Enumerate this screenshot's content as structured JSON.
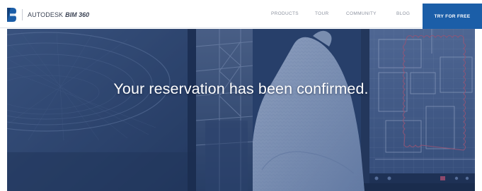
{
  "header": {
    "brand": "AUTODESK",
    "product": "BIM 360",
    "nav": [
      "PRODUCTS",
      "TOUR",
      "COMMUNITY",
      "BLOG"
    ],
    "cta_label": "TRY FOR FREE"
  },
  "hero": {
    "heading": "Your reservation has been confirmed."
  },
  "icons": {
    "logo": "autodesk-b-logo-icon"
  },
  "colors": {
    "brand_blue": "#1b5ea8",
    "hero_overlay": "#2c4a7e",
    "nav_text": "#8d93a0"
  }
}
